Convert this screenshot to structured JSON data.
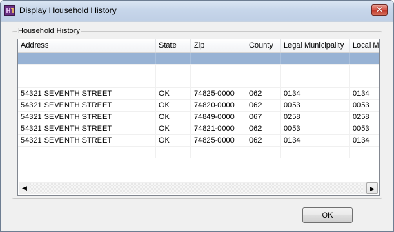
{
  "window": {
    "title": "Display Household History",
    "close_label": "✕",
    "icon": "app-icon"
  },
  "group": {
    "label": "Household History"
  },
  "table": {
    "columns": [
      "Address",
      "State",
      "Zip",
      "County",
      "Legal Municipality",
      "Local M"
    ],
    "rows": [
      [
        "",
        "",
        "",
        "",
        "",
        ""
      ],
      [
        "",
        "",
        "",
        "",
        "",
        ""
      ],
      [
        "",
        "",
        "",
        "",
        "",
        ""
      ],
      [
        "54321 SEVENTH STREET",
        "OK",
        "74825-0000",
        "062",
        "0134",
        "0134"
      ],
      [
        "54321 SEVENTH STREET",
        "OK",
        "74820-0000",
        "062",
        "0053",
        "0053"
      ],
      [
        "54321 SEVENTH STREET",
        "OK",
        "74849-0000",
        "067",
        "0258",
        "0258"
      ],
      [
        "54321 SEVENTH STREET",
        "OK",
        "74821-0000",
        "062",
        "0053",
        "0053"
      ],
      [
        "54321 SEVENTH STREET",
        "OK",
        "74825-0000",
        "062",
        "0134",
        "0134"
      ],
      [
        "",
        "",
        "",
        "",
        "",
        ""
      ]
    ],
    "selected_row": 0
  },
  "scrollbar": {
    "left_arrow": "◀",
    "right_arrow": "▶"
  },
  "footer": {
    "ok_label": "OK"
  }
}
